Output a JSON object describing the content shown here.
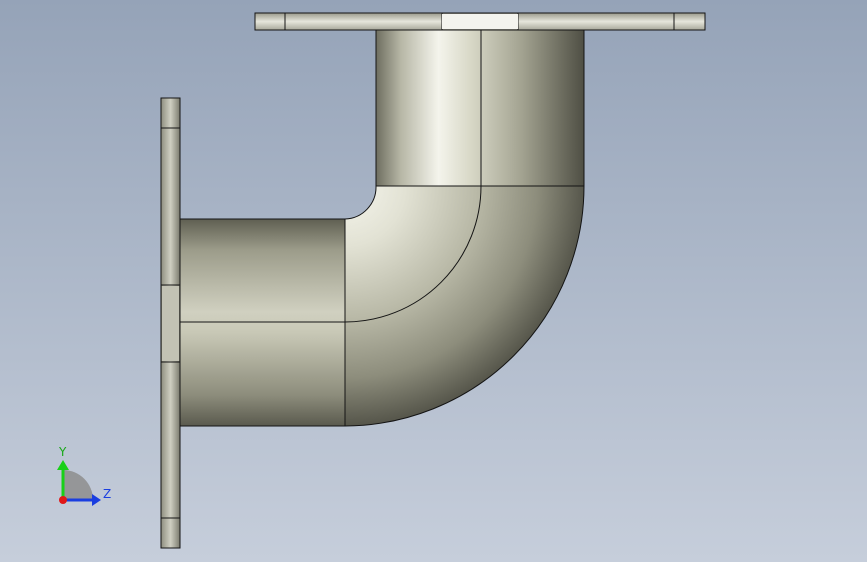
{
  "viewport": {
    "background_top": "#95a3b8",
    "background_bottom": "#c6cedb"
  },
  "model": {
    "part_name": "pipe-elbow-with-flanges",
    "metal_light": "#f2f2ea",
    "metal_mid": "#c4c4b4",
    "metal_dark": "#5d5d50",
    "edge_color": "#141414"
  },
  "triad": {
    "y_label": "Y",
    "z_label": "Z",
    "y_color": "#18d018",
    "z_color": "#1a3ee0",
    "x_color": "#e01818"
  }
}
